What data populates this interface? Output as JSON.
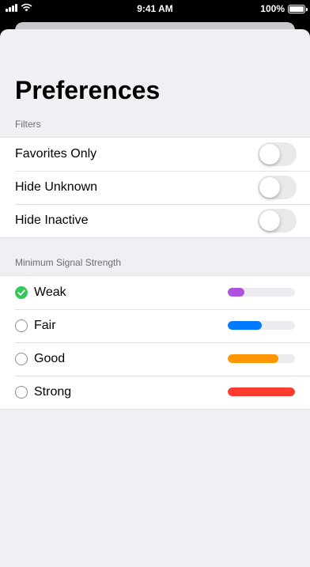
{
  "status_bar": {
    "time": "9:41 AM",
    "battery": "100%",
    "battery_level": 1.0,
    "icons": [
      "cellular-signal-icon",
      "wifi-icon",
      "battery-icon"
    ]
  },
  "page": {
    "title": "Preferences"
  },
  "filters": {
    "header": "Filters",
    "items": [
      {
        "label": "Favorites Only",
        "on": false
      },
      {
        "label": "Hide Unknown",
        "on": false
      },
      {
        "label": "Hide Inactive",
        "on": false
      }
    ]
  },
  "signal": {
    "header": "Minimum Signal Strength",
    "selected": "Weak",
    "options": [
      {
        "label": "Weak",
        "selected": true,
        "level": 0.25,
        "color": "#af52de"
      },
      {
        "label": "Fair",
        "selected": false,
        "level": 0.5,
        "color": "#007aff"
      },
      {
        "label": "Good",
        "selected": false,
        "level": 0.75,
        "color": "#ff9500"
      },
      {
        "label": "Strong",
        "selected": false,
        "level": 1.0,
        "color": "#ff3b30"
      }
    ]
  },
  "colors": {
    "checkmark": "#34c759",
    "toggle_off": "#e9e9ea",
    "background": "#efeff4"
  }
}
